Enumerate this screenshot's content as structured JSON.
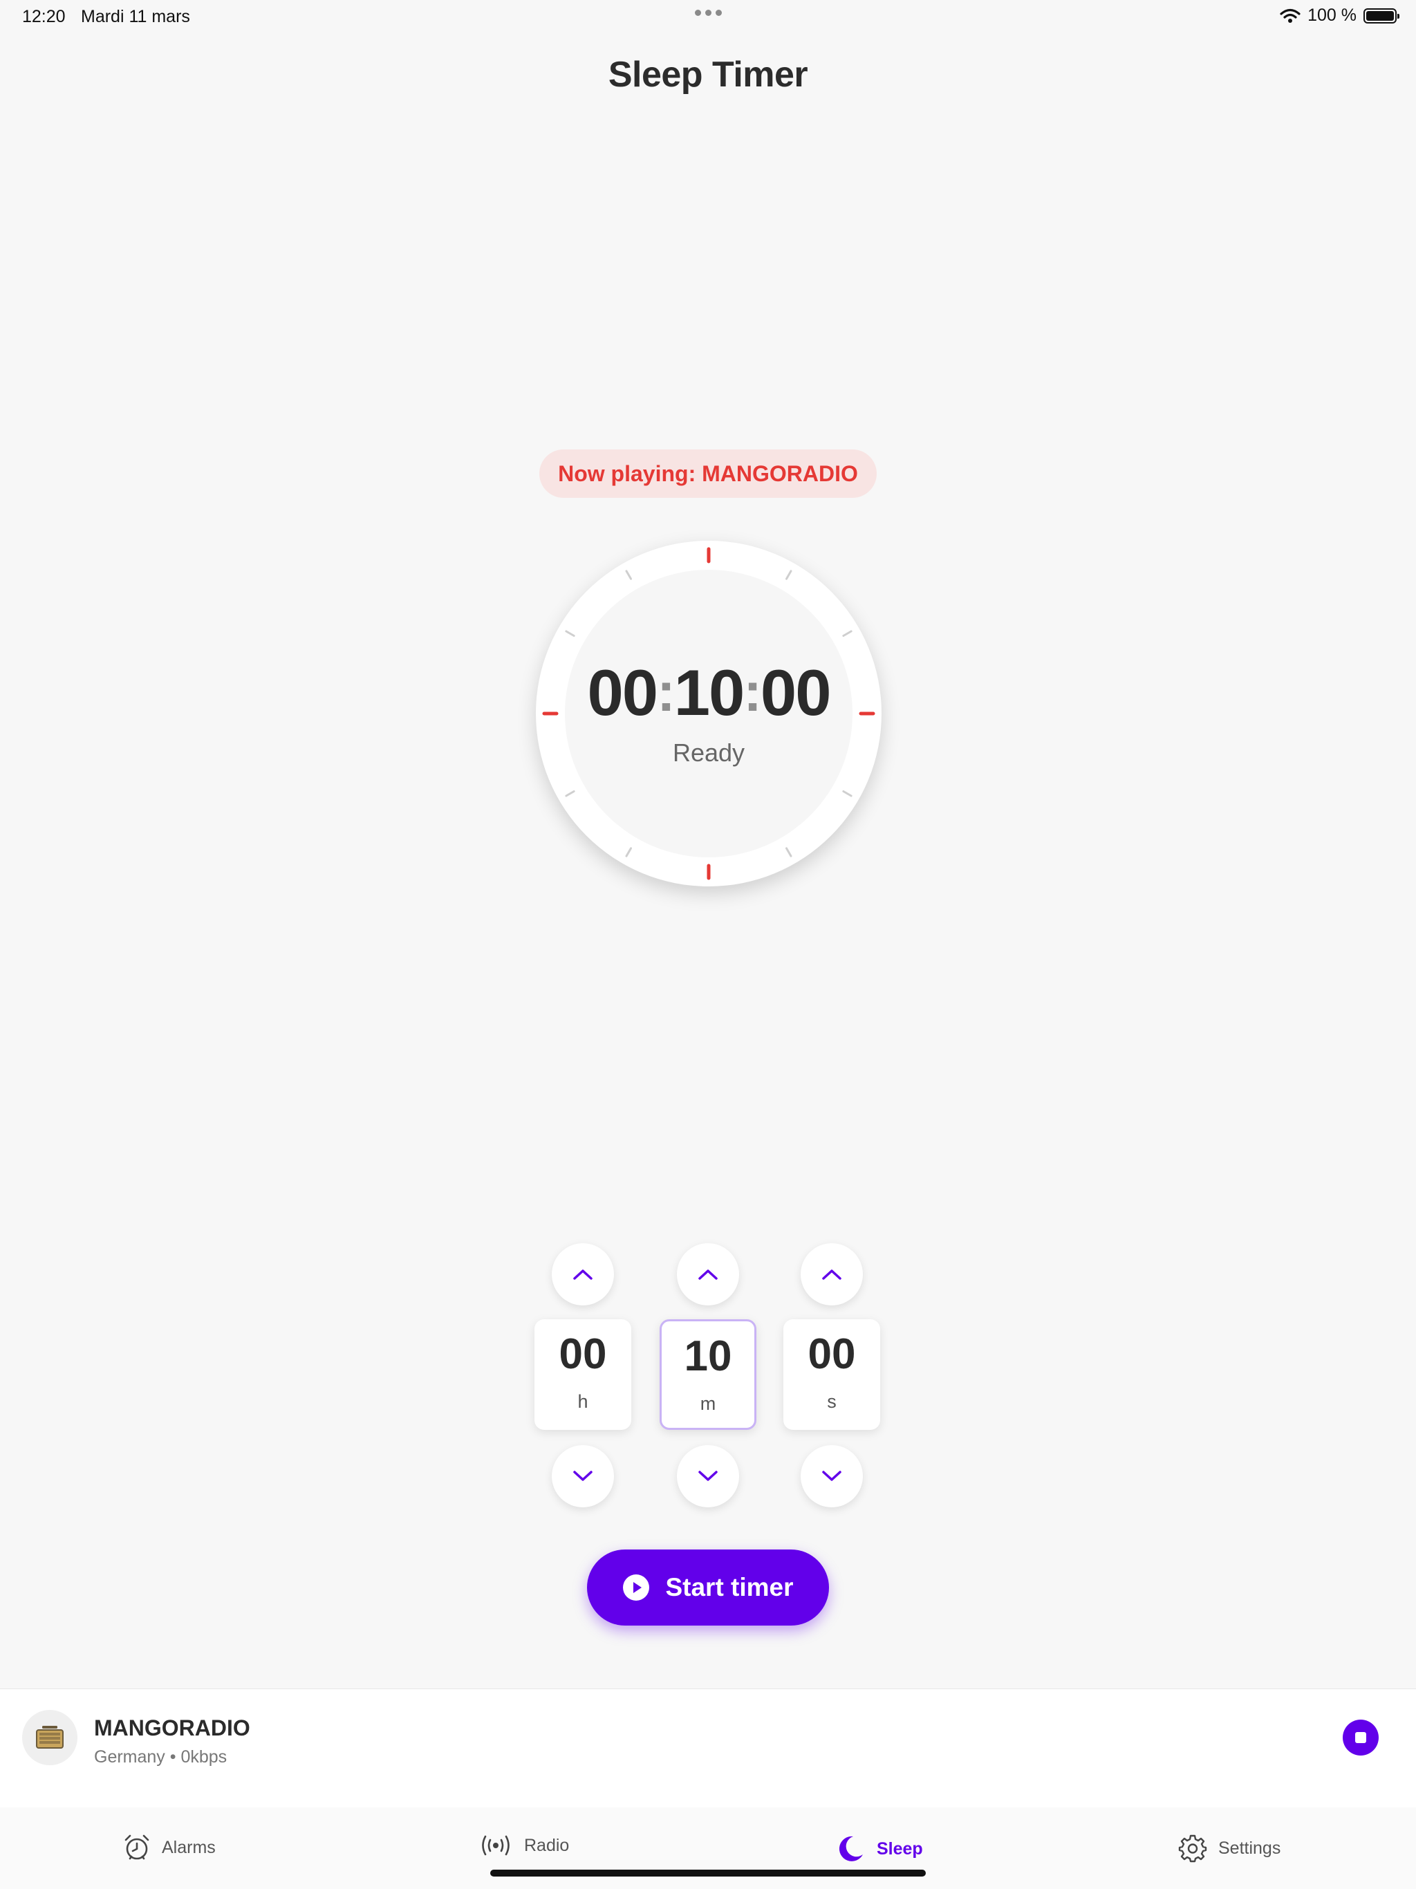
{
  "status_bar": {
    "time": "12:20",
    "date": "Mardi 11 mars",
    "battery": "100 %"
  },
  "header": {
    "title": "Sleep Timer"
  },
  "now_playing": {
    "text": "Now playing: MANGORADIO"
  },
  "timer": {
    "hours": "00",
    "minutes": "10",
    "seconds": "00",
    "colon": ":",
    "state": "Ready"
  },
  "pickers": {
    "hours": {
      "value": "00",
      "unit": "h"
    },
    "minutes": {
      "value": "10",
      "unit": "m"
    },
    "seconds": {
      "value": "00",
      "unit": "s"
    },
    "selected": "minutes"
  },
  "start_button": {
    "label": "Start timer"
  },
  "mini_player": {
    "station": "MANGORADIO",
    "details": "Germany • 0kbps"
  },
  "tabs": [
    {
      "label": "Alarms",
      "icon": "alarm-clock-icon",
      "active": false
    },
    {
      "label": "Radio",
      "icon": "broadcast-icon",
      "active": false
    },
    {
      "label": "Sleep",
      "icon": "moon-icon",
      "active": true
    },
    {
      "label": "Settings",
      "icon": "gear-icon",
      "active": false
    }
  ],
  "colors": {
    "accent": "#6200ea",
    "now_playing_text": "#e53935",
    "now_playing_bg": "#f8e4e3",
    "tick_major": "#e53935",
    "tick_minor": "#cfcfcf"
  }
}
